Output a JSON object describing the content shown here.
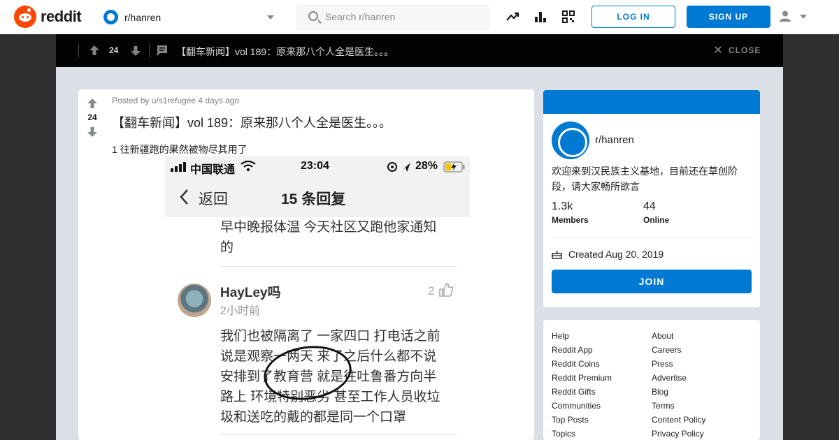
{
  "header": {
    "logo_text": "reddit",
    "subreddit": "r/hanren",
    "search_placeholder": "Search r/hanren",
    "login_label": "LOG IN",
    "signup_label": "SIGN UP",
    "accent_color": "#0079d3",
    "brand_color": "#ff4500"
  },
  "postbar": {
    "score": "24",
    "title": "【翻车新闻】vol 189：原来那八个人全是医生。。。",
    "close_label": "CLOSE"
  },
  "post": {
    "score": "24",
    "meta": "Posted by u/s1refugee 4 days ago",
    "title": "【翻车新闻】vol 189：原来那八个人全是医生。。。",
    "body": "1 往新疆跑的果然被物尽其用了",
    "image": {
      "carrier": "中国联通",
      "time": "23:04",
      "battery": "28%",
      "back": "返回",
      "nav_title": "15 条回复",
      "prev_comment": [
        "早中晚报体温 今天社区又跑他家通知",
        "的"
      ],
      "username": "HayLey吗",
      "comment_time": "2小时前",
      "likes": "2",
      "comment_lines": [
        "我们也被隔离了 一家四口 打电话之前",
        "说是观察一两天 来了之后什么都不说",
        "安排到了教育营 就是往吐鲁番方向半",
        "路上 环境特别恶劣 甚至工作人员收垃",
        "圾和送吃的戴的都是同一个口罩"
      ]
    }
  },
  "sidebar": {
    "name": "r/hanren",
    "description": "欢迎来到汉民族主义基地，目前还在草创阶段，请大家畅所欲言",
    "members_count": "1.3k",
    "members_label": "Members",
    "online_count": "44",
    "online_label": "Online",
    "created": "Created Aug 20, 2019",
    "join_label": "JOIN"
  },
  "footer_links": {
    "left": [
      "Help",
      "Reddit App",
      "Reddit Coins",
      "Reddit Premium",
      "Reddit Gifts",
      "Communities",
      "Top Posts",
      "Topics"
    ],
    "right": [
      "About",
      "Careers",
      "Press",
      "Advertise",
      "Blog",
      "Terms",
      "Content Policy",
      "Privacy Policy"
    ]
  },
  "icons": [
    "reddit-logo-icon",
    "subreddit-icon",
    "chevron-down-icon",
    "search-icon",
    "trending-icon",
    "leaderboard-icon",
    "qr-code-icon",
    "user-icon",
    "upvote-icon",
    "downvote-icon",
    "comment-icon",
    "close-icon",
    "cake-icon"
  ]
}
